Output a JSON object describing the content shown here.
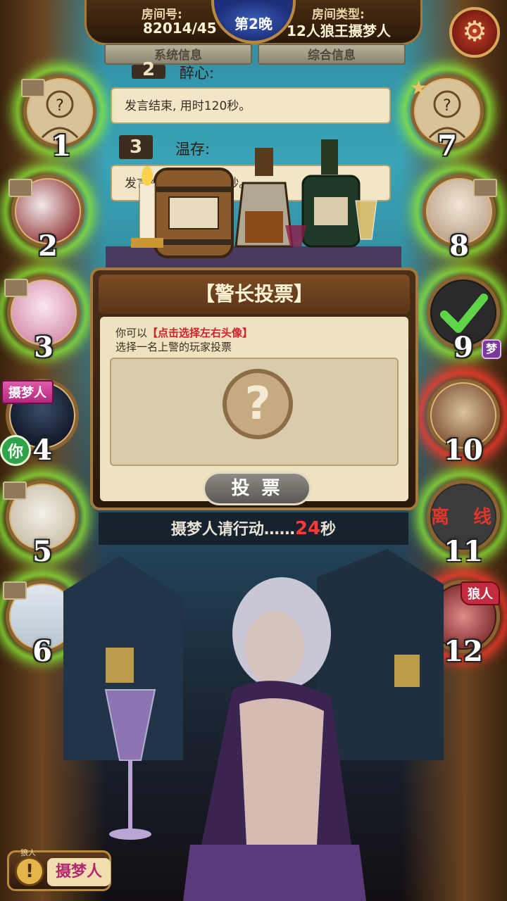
{
  "header": {
    "room_number_label": "房间号:",
    "room_number": "82014/45",
    "room_type_label": "房间类型:",
    "room_type": "12人狼王摄梦人",
    "night": "第2晚"
  },
  "tabs": [
    {
      "label": "系统信息"
    },
    {
      "label": "综合信息"
    }
  ],
  "chat": [
    {
      "num": "2",
      "name": "醉心:"
    },
    {
      "text": "发言结束, 用时120秒。"
    },
    {
      "num": "3",
      "name": "温存:"
    },
    {
      "text": "发言结束, 用时120秒。"
    }
  ],
  "players": [
    {
      "number": "1"
    },
    {
      "number": "2"
    },
    {
      "number": "3"
    },
    {
      "number": "4",
      "role_tag": "摄梦人",
      "you_tag": "你"
    },
    {
      "number": "5"
    },
    {
      "number": "6"
    },
    {
      "number": "7"
    },
    {
      "number": "8"
    },
    {
      "number": "9",
      "badge": "梦"
    },
    {
      "number": "10"
    },
    {
      "number": "11",
      "status_left": "离",
      "status_right": "线"
    },
    {
      "number": "12",
      "role_tag": "狼人"
    }
  ],
  "modal": {
    "title": "【警长投票】",
    "line1_prefix": "你可以",
    "line1_highlight": "【点击选择左右头像】",
    "line2": "选择一名上警的玩家投票",
    "target_placeholder": "?",
    "vote_button": "投 票"
  },
  "status": {
    "text": "摄梦人请行动……",
    "seconds": "24",
    "unit": "秒"
  },
  "role_button": {
    "small_label": "狼人",
    "label": "摄梦人",
    "icon": "!"
  },
  "colors": {
    "alive_glow": "#8cf03a",
    "danger_glow": "#ff3b2f",
    "highlight_text": "#d4202a",
    "role_tag": "#c93a8c"
  }
}
